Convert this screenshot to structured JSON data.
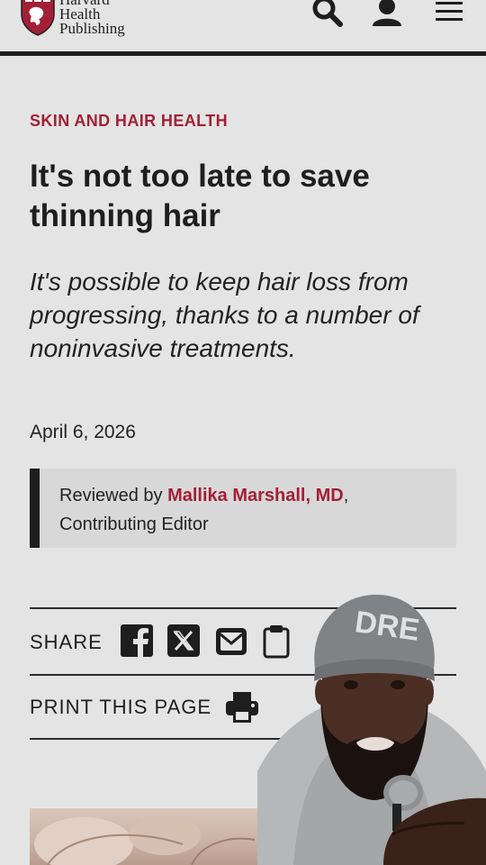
{
  "header": {
    "logo_line1": "Harvard",
    "logo_line2": "Health",
    "logo_line3": "Publishing",
    "search_icon": "search-icon",
    "account_icon": "user-icon",
    "menu_icon": "hamburger-menu-icon"
  },
  "article": {
    "category": "SKIN AND HAIR HEALTH",
    "title": "It's not too late to save thinning hair",
    "subtitle": "It's possible to keep hair loss from progressing, thanks to a number of noninvasive treatments.",
    "date": "April 6, 2026",
    "reviewed_prefix": "Reviewed by ",
    "reviewer_name": "Mallika Marshall, MD",
    "reviewer_suffix": ",",
    "reviewer_role": "Contributing Editor"
  },
  "share": {
    "label": "SHARE",
    "icons": [
      "facebook-icon",
      "x-icon",
      "email-icon",
      "clipboard-icon"
    ]
  },
  "print": {
    "label": "PRINT THIS PAGE",
    "icon": "printer-icon"
  },
  "overlay": {
    "beanie_text": "DRE"
  },
  "colors": {
    "accent": "#a31f37",
    "background": "#e4e4e4",
    "text": "#1e1e1e"
  }
}
